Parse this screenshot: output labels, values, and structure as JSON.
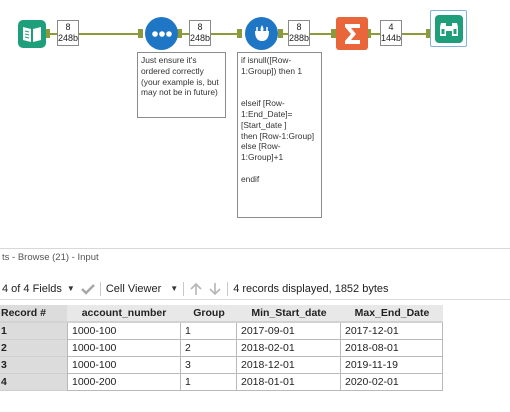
{
  "canvas": {
    "tools": [
      {
        "name": "input-data-tool",
        "icon": "book-icon",
        "color": "#1e9e7b"
      },
      {
        "name": "sort-tool",
        "icon": "three-dots-icon",
        "color": "#1f76c4"
      },
      {
        "name": "multi-row-formula-tool",
        "icon": "multi-row-formula-icon",
        "color": "#1f76c4"
      },
      {
        "name": "summarize-tool",
        "icon": "sigma-icon",
        "color": "#e8663a"
      },
      {
        "name": "browse-tool",
        "icon": "binoculars-icon",
        "color": "#1e9e7b"
      }
    ],
    "metadata": [
      {
        "fields": "8",
        "size": "248b"
      },
      {
        "fields": "8",
        "size": "248b"
      },
      {
        "fields": "8",
        "size": "288b"
      },
      {
        "fields": "4",
        "size": "144b"
      }
    ],
    "annotations": {
      "sort_note": "Just ensure it's ordered correctly (your example is, but may not be in future)",
      "formula_note": "if isnull([Row-1:Group]) then 1\n\n\nelseif [Row-1:End_Date]=\n[Start_date ]\nthen [Row-1:Group]\nelse [Row-1:Group]+1\n\nendif"
    },
    "connection_color": "#8c9a3b"
  },
  "results": {
    "panel_title": "ts - Browse (21) - Input",
    "toolbar": {
      "fields": "4 of 4 Fields",
      "cell_viewer": "Cell Viewer",
      "status": "4 records displayed, 1852 bytes"
    },
    "columns": [
      "Record #",
      "account_number",
      "Group",
      "Min_Start_date",
      "Max_End_Date"
    ],
    "rows": [
      [
        "1",
        "1000-100",
        "1",
        "2017-09-01",
        "2017-12-01"
      ],
      [
        "2",
        "1000-100",
        "2",
        "2018-02-01",
        "2018-08-01"
      ],
      [
        "3",
        "1000-100",
        "3",
        "2018-12-01",
        "2019-11-19"
      ],
      [
        "4",
        "1000-200",
        "1",
        "2018-01-01",
        "2020-02-01"
      ]
    ]
  }
}
